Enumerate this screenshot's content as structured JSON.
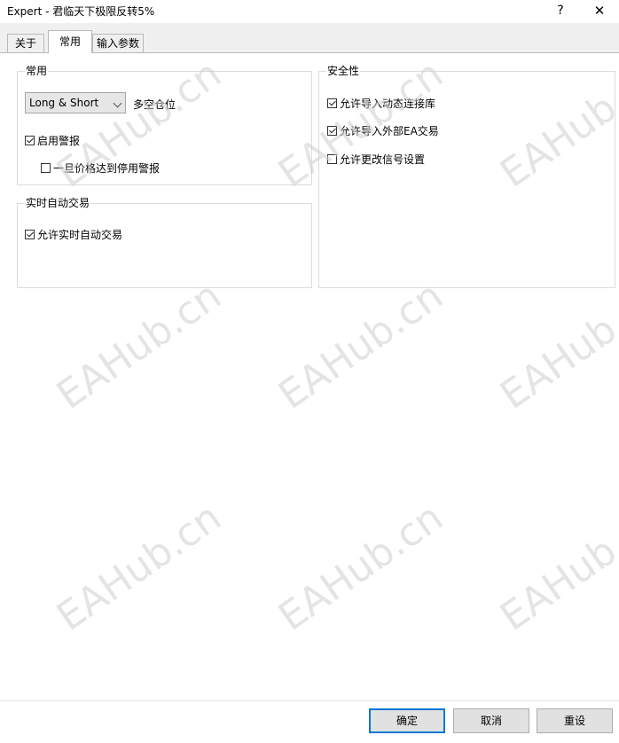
{
  "window": {
    "title": "Expert - 君临天下极限反转5%",
    "help_label": "?",
    "close_label": "✕"
  },
  "tabs": [
    {
      "label": "关于"
    },
    {
      "label": "常用",
      "active": true
    },
    {
      "label": "输入参数"
    }
  ],
  "general": {
    "group_title": "常用",
    "position_select": {
      "selected": "Long & Short",
      "label": "多空仓位"
    },
    "enable_alerts": {
      "label": "启用警报",
      "checked": true
    },
    "disable_alert_on_price": {
      "label": "一旦价格达到停用警报",
      "checked": false
    }
  },
  "live_trading": {
    "group_title": "实时自动交易",
    "allow_live_trading": {
      "label": "允许实时自动交易",
      "checked": true
    }
  },
  "security": {
    "group_title": "安全性",
    "allow_dll": {
      "label": "允许导入动态连接库",
      "checked": true
    },
    "allow_external_ea": {
      "label": "允许导入外部EA交易",
      "checked": true
    },
    "allow_signal_settings": {
      "label": "允许更改信号设置",
      "checked": false
    }
  },
  "buttons": {
    "ok": "确定",
    "cancel": "取消",
    "reset": "重设"
  },
  "watermark_text": "EAHub.cn"
}
